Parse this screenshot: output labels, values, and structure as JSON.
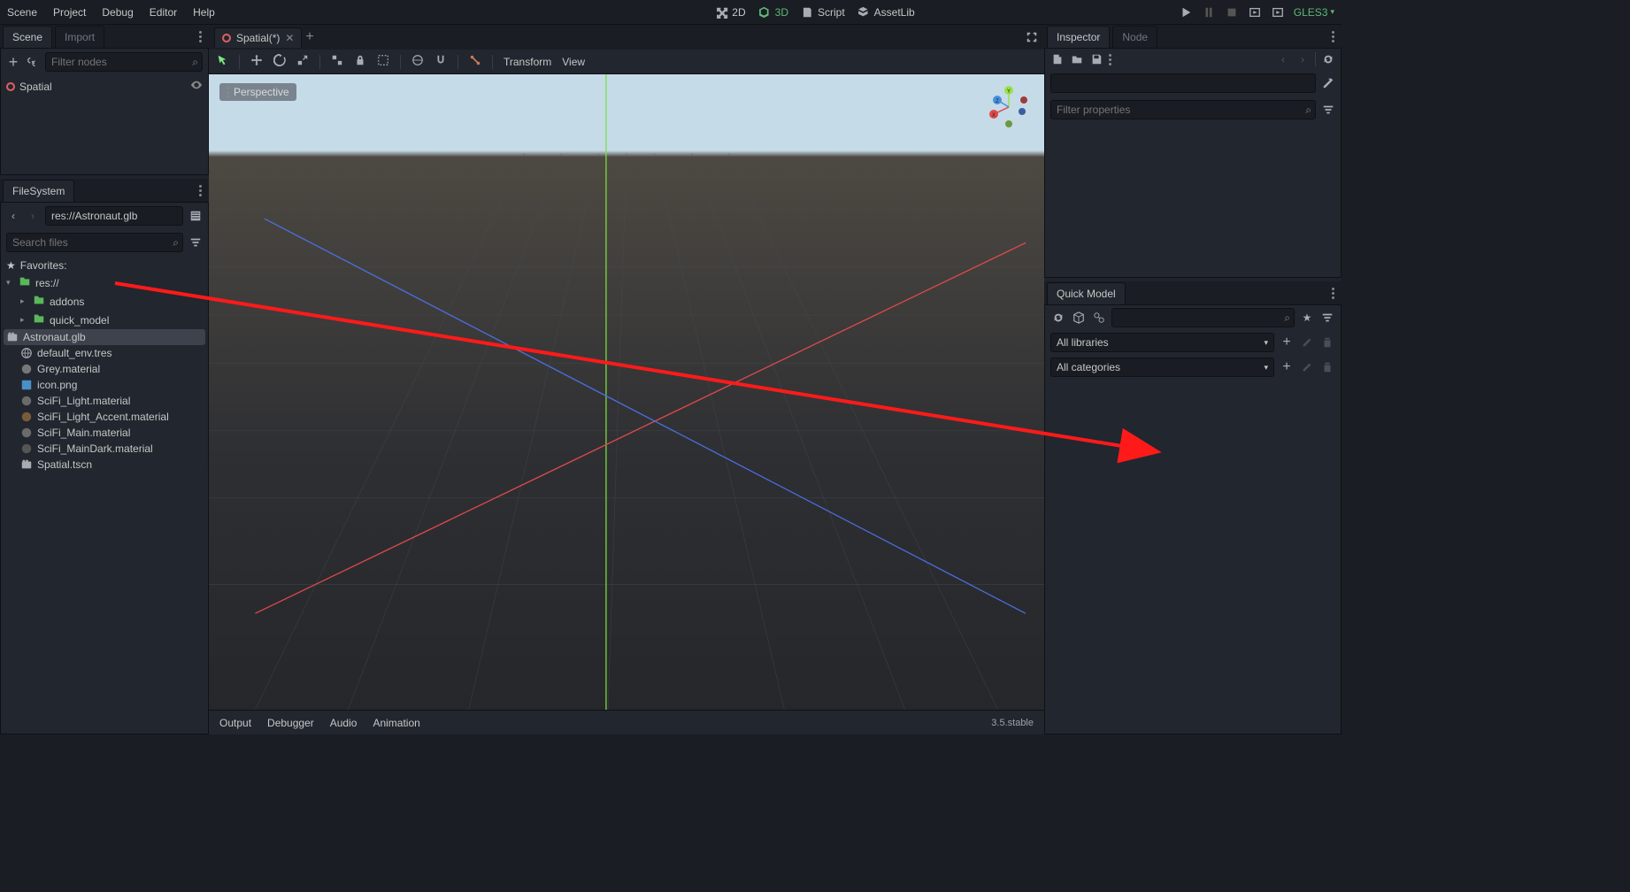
{
  "menubar": [
    "Scene",
    "Project",
    "Debug",
    "Editor",
    "Help"
  ],
  "top_center": {
    "mode_2d": "2D",
    "mode_3d": "3D",
    "script": "Script",
    "assetlib": "AssetLib"
  },
  "renderer": "GLES3",
  "scene_panel": {
    "tab_scene": "Scene",
    "tab_import": "Import",
    "filter_placeholder": "Filter nodes",
    "root_node": "Spatial"
  },
  "filesystem": {
    "title": "FileSystem",
    "path": "res://Astronaut.glb",
    "search_placeholder": "Search files",
    "favorites": "Favorites:",
    "root": "res://",
    "folders": [
      "addons",
      "quick_model"
    ],
    "files": [
      "Astronaut.glb",
      "default_env.tres",
      "Grey.material",
      "icon.png",
      "SciFi_Light.material",
      "SciFi_Light_Accent.material",
      "SciFi_Main.material",
      "SciFi_MainDark.material",
      "Spatial.tscn"
    ]
  },
  "scene_tab": {
    "name": "Spatial(*)"
  },
  "viewport_toolbar": {
    "transform": "Transform",
    "view": "View"
  },
  "perspective": "Perspective",
  "inspector": {
    "tab_inspector": "Inspector",
    "tab_node": "Node",
    "filter_placeholder": "Filter properties"
  },
  "quick_model": {
    "title": "Quick Model",
    "libraries": "All libraries",
    "categories": "All categories"
  },
  "bottom_panel": {
    "items": [
      "Output",
      "Debugger",
      "Audio",
      "Animation"
    ],
    "version": "3.5.stable"
  }
}
